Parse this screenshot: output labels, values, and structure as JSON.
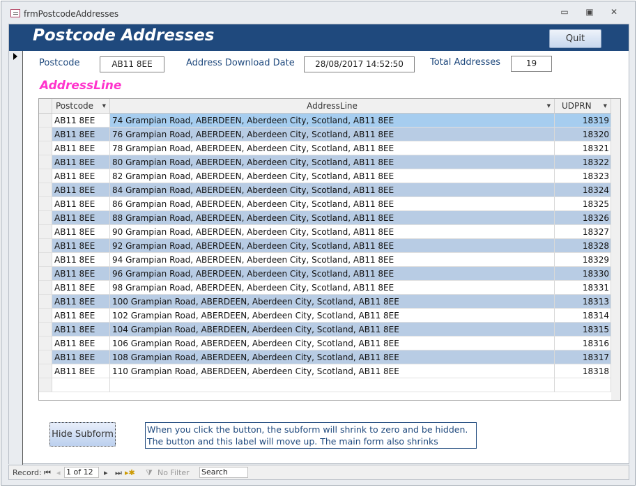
{
  "window": {
    "title": "frmPostcodeAddresses",
    "minimize": "▭",
    "restore": "▣",
    "close": "✕"
  },
  "header": {
    "title": "Postcode Addresses",
    "quit_label": "Quit"
  },
  "fields": {
    "postcode_label": "Postcode",
    "postcode_value": "AB11 8EE",
    "date_label": "Address Download Date",
    "date_value": "28/08/2017 14:52:50",
    "total_label": "Total Addresses",
    "total_value": "19"
  },
  "subform": {
    "label": "AddressLine",
    "columns": [
      "Postcode",
      "AddressLine",
      "UDPRN"
    ],
    "rows": [
      [
        "AB11 8EE",
        "74 Grampian Road, ABERDEEN, Aberdeen City, Scotland, AB11 8EE",
        "18319"
      ],
      [
        "AB11 8EE",
        "76 Grampian Road, ABERDEEN, Aberdeen City, Scotland, AB11 8EE",
        "18320"
      ],
      [
        "AB11 8EE",
        "78 Grampian Road, ABERDEEN, Aberdeen City, Scotland, AB11 8EE",
        "18321"
      ],
      [
        "AB11 8EE",
        "80 Grampian Road, ABERDEEN, Aberdeen City, Scotland, AB11 8EE",
        "18322"
      ],
      [
        "AB11 8EE",
        "82 Grampian Road, ABERDEEN, Aberdeen City, Scotland, AB11 8EE",
        "18323"
      ],
      [
        "AB11 8EE",
        "84 Grampian Road, ABERDEEN, Aberdeen City, Scotland, AB11 8EE",
        "18324"
      ],
      [
        "AB11 8EE",
        "86 Grampian Road, ABERDEEN, Aberdeen City, Scotland, AB11 8EE",
        "18325"
      ],
      [
        "AB11 8EE",
        "88 Grampian Road, ABERDEEN, Aberdeen City, Scotland, AB11 8EE",
        "18326"
      ],
      [
        "AB11 8EE",
        "90 Grampian Road, ABERDEEN, Aberdeen City, Scotland, AB11 8EE",
        "18327"
      ],
      [
        "AB11 8EE",
        "92 Grampian Road, ABERDEEN, Aberdeen City, Scotland, AB11 8EE",
        "18328"
      ],
      [
        "AB11 8EE",
        "94 Grampian Road, ABERDEEN, Aberdeen City, Scotland, AB11 8EE",
        "18329"
      ],
      [
        "AB11 8EE",
        "96 Grampian Road, ABERDEEN, Aberdeen City, Scotland, AB11 8EE",
        "18330"
      ],
      [
        "AB11 8EE",
        "98 Grampian Road, ABERDEEN, Aberdeen City, Scotland, AB11 8EE",
        "18331"
      ],
      [
        "AB11 8EE",
        "100 Grampian Road, ABERDEEN, Aberdeen City, Scotland, AB11 8EE",
        "18313"
      ],
      [
        "AB11 8EE",
        "102 Grampian Road, ABERDEEN, Aberdeen City, Scotland, AB11 8EE",
        "18314"
      ],
      [
        "AB11 8EE",
        "104 Grampian Road, ABERDEEN, Aberdeen City, Scotland, AB11 8EE",
        "18315"
      ],
      [
        "AB11 8EE",
        "106 Grampian Road, ABERDEEN, Aberdeen City, Scotland, AB11 8EE",
        "18316"
      ],
      [
        "AB11 8EE",
        "108 Grampian Road, ABERDEEN, Aberdeen City, Scotland, AB11 8EE",
        "18317"
      ],
      [
        "AB11 8EE",
        "110 Grampian Road, ABERDEEN, Aberdeen City, Scotland, AB11 8EE",
        "18318"
      ]
    ]
  },
  "hide_button_label": "Hide Subform",
  "note": "When you click the button, the subform will shrink to zero and be hidden. The button and this label will move up. The main form also shrinks",
  "navigation": {
    "record_label": "Record:",
    "first": "⏮",
    "prev": "◂",
    "position": "1 of 12",
    "next": "▸",
    "last": "⏭",
    "new": "▸✱",
    "filter": "No Filter",
    "search": "Search"
  },
  "colors": {
    "header": "#1f497d",
    "alt_row": "#b8cce4",
    "selected_row": "#a6cdef",
    "label_pink": "#ff33cc"
  }
}
